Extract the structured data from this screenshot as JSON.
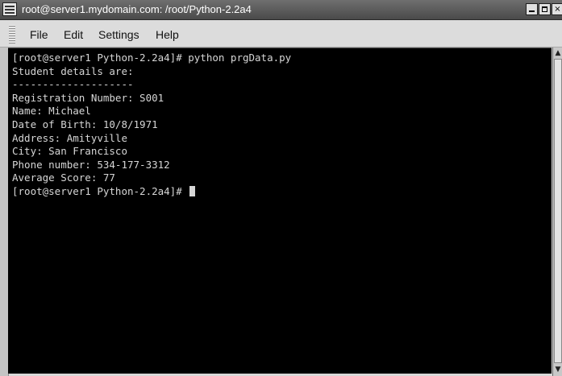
{
  "window": {
    "title": "root@server1.mydomain.com: /root/Python-2.2a4",
    "min_glyph": "minimize",
    "max_glyph": "maximize",
    "close_glyph": "×"
  },
  "menubar": {
    "items": [
      {
        "label": "File"
      },
      {
        "label": "Edit"
      },
      {
        "label": "Settings"
      },
      {
        "label": "Help"
      }
    ]
  },
  "terminal": {
    "lines": [
      "[root@server1 Python-2.2a4]# python prgData.py",
      "Student details are:",
      "--------------------",
      "Registration Number: S001",
      "Name: Michael",
      "Date of Birth: 10/8/1971",
      "Address: Amityville",
      "City: San Francisco",
      "Phone number: 534-177-3312",
      "Average Score: 77",
      "[root@server1 Python-2.2a4]# "
    ],
    "colors": {
      "background": "#000000",
      "foreground": "#d6d6d6"
    }
  },
  "scrollbar": {
    "up_arrow": "▲",
    "down_arrow": "▼"
  }
}
